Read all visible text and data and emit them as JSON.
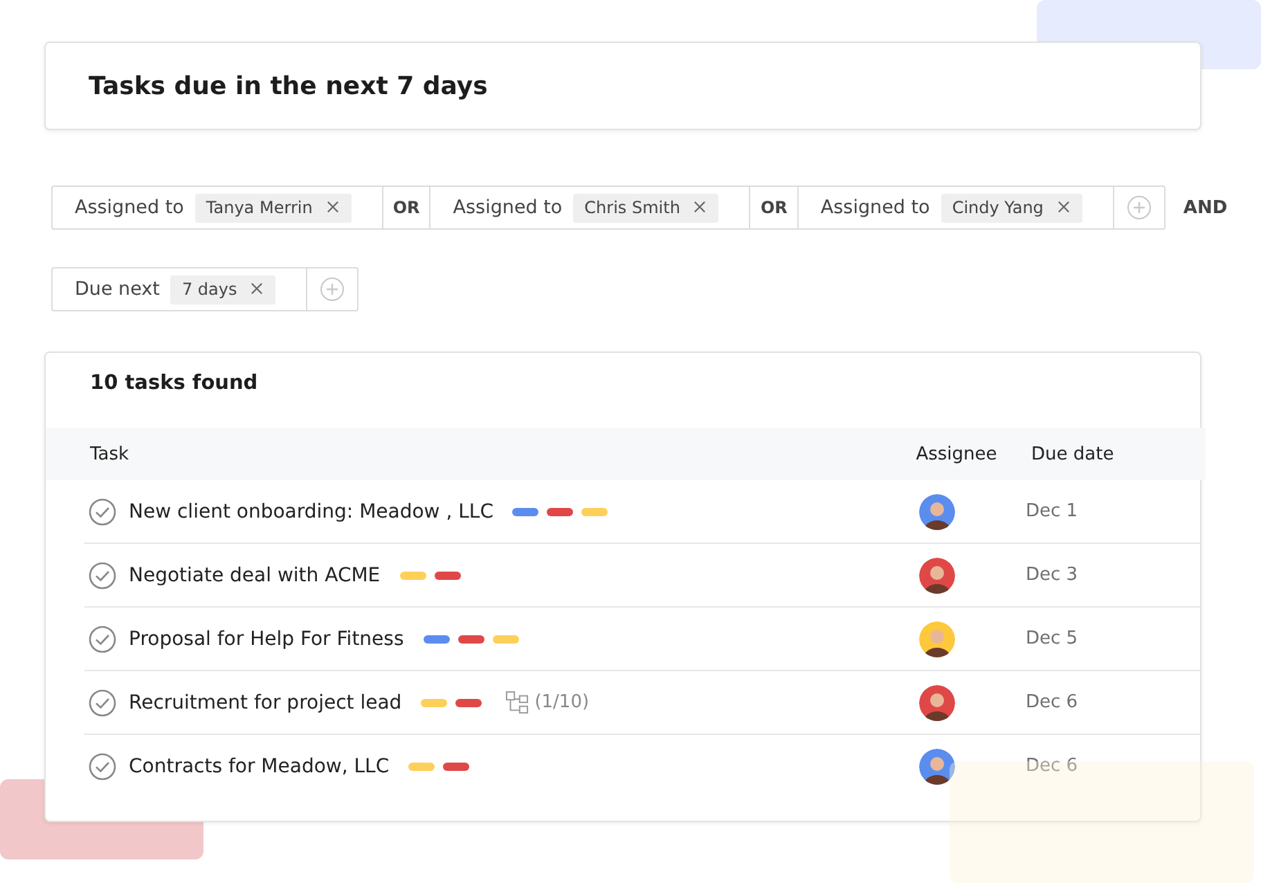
{
  "title": "Tasks due in the next 7 days",
  "filter_rows": [
    {
      "items": [
        {
          "kind": "condition",
          "label": "Assigned to",
          "chip": "Tanya Merrin"
        },
        {
          "kind": "operator",
          "label": "OR"
        },
        {
          "kind": "condition",
          "label": "Assigned to",
          "chip": "Chris Smith"
        },
        {
          "kind": "operator",
          "label": "OR"
        },
        {
          "kind": "condition",
          "label": "Assigned to",
          "chip": "Cindy Yang"
        },
        {
          "kind": "add"
        }
      ],
      "join": "AND"
    },
    {
      "items": [
        {
          "kind": "condition",
          "label": "Due next",
          "chip": "7 days"
        },
        {
          "kind": "add"
        }
      ]
    }
  ],
  "results": {
    "count": "10 tasks found",
    "columns": [
      "Task",
      "Assignee",
      "Due date"
    ],
    "rows": [
      {
        "task": "New client onboarding: Meadow , LLC",
        "tags": [
          {
            "color": "#5b8def"
          },
          {
            "color": "#e04848"
          },
          {
            "color": "#fdd05a"
          }
        ],
        "avatar": {
          "color": "#5b8def"
        },
        "due": "Dec 1"
      },
      {
        "task": "Negotiate deal with ACME",
        "tags": [
          {
            "color": "#fdd05a"
          },
          {
            "color": "#e04848"
          }
        ],
        "avatar": {
          "color": "#e04848"
        },
        "due": "Dec 3"
      },
      {
        "task": "Proposal for Help For Fitness",
        "tags": [
          {
            "color": "#5b8def"
          },
          {
            "color": "#e04848"
          },
          {
            "color": "#fdd05a"
          }
        ],
        "avatar": {
          "color": "#fdc83c"
        },
        "due": "Dec 5"
      },
      {
        "task": "Recruitment for project lead",
        "tags": [
          {
            "color": "#fdd05a"
          },
          {
            "color": "#e04848"
          }
        ],
        "subtasks": "(1/10)",
        "avatar": {
          "color": "#e04848"
        },
        "due": "Dec 6"
      },
      {
        "task": "Contracts for Meadow, LLC",
        "tags": [
          {
            "color": "#fdd05a"
          },
          {
            "color": "#e04848"
          }
        ],
        "avatar": {
          "color": "#5b8def"
        },
        "due": "Dec 6"
      }
    ]
  }
}
